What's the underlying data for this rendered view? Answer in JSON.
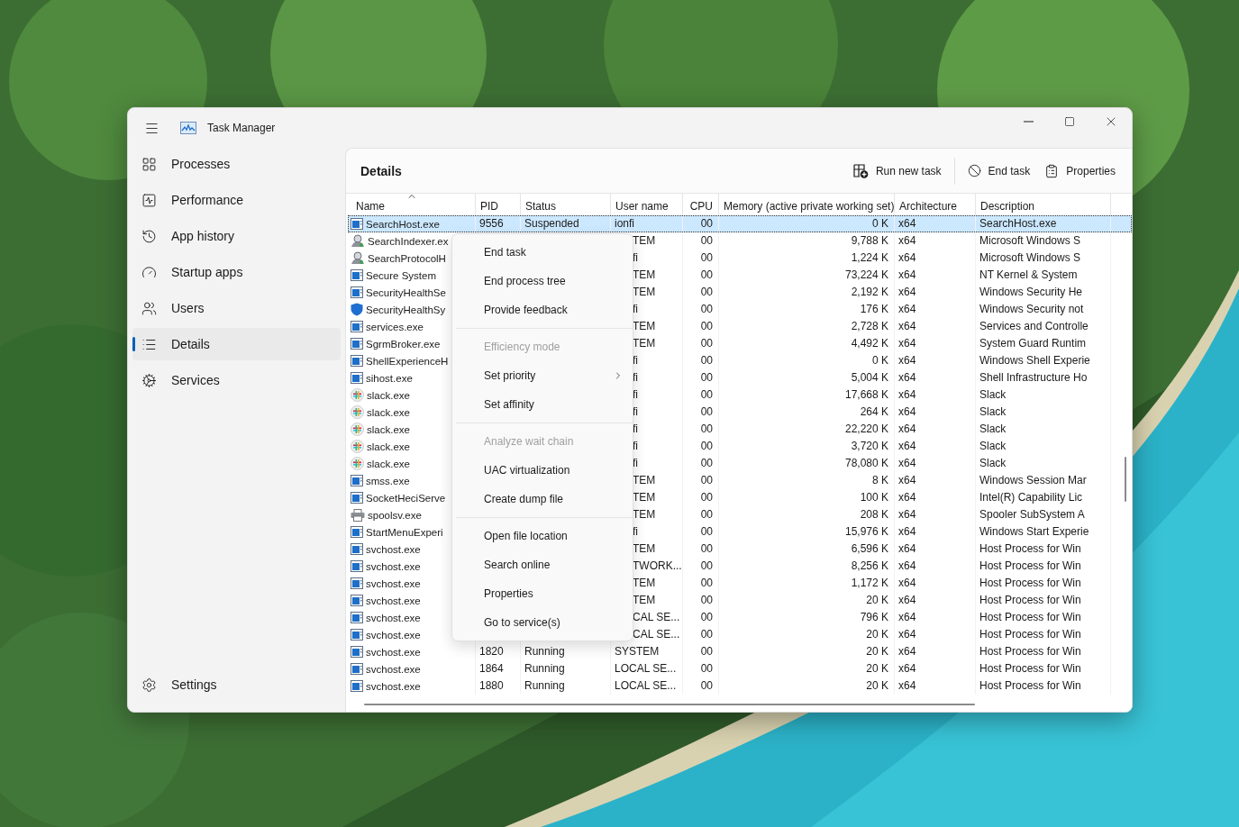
{
  "window": {
    "title": "Task Manager"
  },
  "sidebar": {
    "items": [
      {
        "label": "Processes",
        "selected": false
      },
      {
        "label": "Performance",
        "selected": false
      },
      {
        "label": "App history",
        "selected": false
      },
      {
        "label": "Startup apps",
        "selected": false
      },
      {
        "label": "Users",
        "selected": false
      },
      {
        "label": "Details",
        "selected": true
      },
      {
        "label": "Services",
        "selected": false
      }
    ],
    "footer": {
      "label": "Settings"
    }
  },
  "panel": {
    "title": "Details",
    "actions": [
      "Run new task",
      "End task",
      "Properties"
    ]
  },
  "table": {
    "columns": [
      {
        "label": "Name",
        "sorted": true
      },
      {
        "label": "PID",
        "sorted": false
      },
      {
        "label": "Status",
        "sorted": false
      },
      {
        "label": "User name",
        "sorted": false
      },
      {
        "label": "CPU",
        "sorted": false
      },
      {
        "label": "Memory (active private working set)",
        "sorted": false
      },
      {
        "label": "Architecture",
        "sorted": false
      },
      {
        "label": "Description",
        "sorted": false
      }
    ],
    "rows": [
      {
        "kind": "app",
        "name": "SearchHost.exe",
        "pid": "9556",
        "status": "Suspended",
        "user": "ionfi",
        "cpu": "00",
        "memory": "0 K",
        "architecture": "x64",
        "description": "SearchHost.exe",
        "selected": true
      },
      {
        "kind": "search",
        "name": "SearchIndexer.ex",
        "user": "TEM",
        "cpu": "00",
        "memory": "9,788 K",
        "architecture": "x64",
        "description": "Microsoft Windows S",
        "selected": false
      },
      {
        "kind": "search",
        "name": "SearchProtocolH",
        "user": "fi",
        "cpu": "00",
        "memory": "1,224 K",
        "architecture": "x64",
        "description": "Microsoft Windows S",
        "selected": false
      },
      {
        "kind": "app",
        "name": "Secure System",
        "user": "TEM",
        "cpu": "00",
        "memory": "73,224 K",
        "architecture": "x64",
        "description": "NT Kernel & System",
        "selected": false
      },
      {
        "kind": "app",
        "name": "SecurityHealthSe",
        "user": "TEM",
        "cpu": "00",
        "memory": "2,192 K",
        "architecture": "x64",
        "description": "Windows Security He",
        "selected": false
      },
      {
        "kind": "shield",
        "name": "SecurityHealthSy",
        "user": "fi",
        "cpu": "00",
        "memory": "176 K",
        "architecture": "x64",
        "description": "Windows Security not",
        "selected": false
      },
      {
        "kind": "app",
        "name": "services.exe",
        "user": "TEM",
        "cpu": "00",
        "memory": "2,728 K",
        "architecture": "x64",
        "description": "Services and Controlle",
        "selected": false
      },
      {
        "kind": "app",
        "name": "SgrmBroker.exe",
        "user": "TEM",
        "cpu": "00",
        "memory": "4,492 K",
        "architecture": "x64",
        "description": "System Guard Runtim",
        "selected": false
      },
      {
        "kind": "app",
        "name": "ShellExperienceH",
        "user": "fi",
        "cpu": "00",
        "memory": "0 K",
        "architecture": "x64",
        "description": "Windows Shell Experie",
        "selected": false
      },
      {
        "kind": "app",
        "name": "sihost.exe",
        "user": "fi",
        "cpu": "00",
        "memory": "5,004 K",
        "architecture": "x64",
        "description": "Shell Infrastructure Ho",
        "selected": false
      },
      {
        "kind": "slack",
        "name": "slack.exe",
        "user": "fi",
        "cpu": "00",
        "memory": "17,668 K",
        "architecture": "x64",
        "description": "Slack",
        "selected": false
      },
      {
        "kind": "slack",
        "name": "slack.exe",
        "user": "fi",
        "cpu": "00",
        "memory": "264 K",
        "architecture": "x64",
        "description": "Slack",
        "selected": false
      },
      {
        "kind": "slack",
        "name": "slack.exe",
        "user": "fi",
        "cpu": "00",
        "memory": "22,220 K",
        "architecture": "x64",
        "description": "Slack",
        "selected": false
      },
      {
        "kind": "slack",
        "name": "slack.exe",
        "user": "fi",
        "cpu": "00",
        "memory": "3,720 K",
        "architecture": "x64",
        "description": "Slack",
        "selected": false
      },
      {
        "kind": "slack",
        "name": "slack.exe",
        "user": "fi",
        "cpu": "00",
        "memory": "78,080 K",
        "architecture": "x64",
        "description": "Slack",
        "selected": false
      },
      {
        "kind": "app",
        "name": "smss.exe",
        "user": "TEM",
        "cpu": "00",
        "memory": "8 K",
        "architecture": "x64",
        "description": "Windows Session Mar",
        "selected": false
      },
      {
        "kind": "app",
        "name": "SocketHeciServe",
        "user": "TEM",
        "cpu": "00",
        "memory": "100 K",
        "architecture": "x64",
        "description": "Intel(R) Capability Lic",
        "selected": false
      },
      {
        "kind": "printer",
        "name": "spoolsv.exe",
        "user": "TEM",
        "cpu": "00",
        "memory": "208 K",
        "architecture": "x64",
        "description": "Spooler SubSystem A",
        "selected": false
      },
      {
        "kind": "app",
        "name": "StartMenuExperi",
        "user": "fi",
        "cpu": "00",
        "memory": "15,976 K",
        "architecture": "x64",
        "description": "Windows Start Experie",
        "selected": false
      },
      {
        "kind": "app",
        "name": "svchost.exe",
        "user": "TEM",
        "cpu": "00",
        "memory": "6,596 K",
        "architecture": "x64",
        "description": "Host Process for Win",
        "selected": false
      },
      {
        "kind": "app",
        "name": "svchost.exe",
        "user": "TWORK...",
        "cpu": "00",
        "memory": "8,256 K",
        "architecture": "x64",
        "description": "Host Process for Win",
        "selected": false
      },
      {
        "kind": "app",
        "name": "svchost.exe",
        "user": "TEM",
        "cpu": "00",
        "memory": "1,172 K",
        "architecture": "x64",
        "description": "Host Process for Win",
        "selected": false
      },
      {
        "kind": "app",
        "name": "svchost.exe",
        "user": "TEM",
        "cpu": "00",
        "memory": "20 K",
        "architecture": "x64",
        "description": "Host Process for Win",
        "selected": false
      },
      {
        "kind": "app",
        "name": "svchost.exe",
        "user": "CAL SE...",
        "cpu": "00",
        "memory": "796 K",
        "architecture": "x64",
        "description": "Host Process for Win",
        "selected": false
      },
      {
        "kind": "app",
        "name": "svchost.exe",
        "user": "CAL SE...",
        "cpu": "00",
        "memory": "20 K",
        "architecture": "x64",
        "description": "Host Process for Win",
        "selected": false
      },
      {
        "kind": "app",
        "name": "svchost.exe",
        "pid": "1820",
        "status": "Running",
        "user": "SYSTEM",
        "cpu": "00",
        "memory": "20 K",
        "architecture": "x64",
        "description": "Host Process for Win",
        "selected": false
      },
      {
        "kind": "app",
        "name": "svchost.exe",
        "pid": "1864",
        "status": "Running",
        "user": "LOCAL SE...",
        "cpu": "00",
        "memory": "20 K",
        "architecture": "x64",
        "description": "Host Process for Win",
        "selected": false
      },
      {
        "kind": "app",
        "name": "svchost.exe",
        "pid": "1880",
        "status": "Running",
        "user": "LOCAL SE...",
        "cpu": "00",
        "memory": "20 K",
        "architecture": "x64",
        "description": "Host Process for Win",
        "selected": false
      }
    ]
  },
  "context_menu": {
    "items": [
      {
        "kind": "item",
        "label": "End task",
        "disabled": false,
        "submenu": false
      },
      {
        "kind": "item",
        "label": "End process tree",
        "disabled": false,
        "submenu": false
      },
      {
        "kind": "item",
        "label": "Provide feedback",
        "disabled": false,
        "submenu": false
      },
      {
        "kind": "separator"
      },
      {
        "kind": "item",
        "label": "Efficiency mode",
        "disabled": true,
        "submenu": false
      },
      {
        "kind": "item",
        "label": "Set priority",
        "disabled": false,
        "submenu": true
      },
      {
        "kind": "item",
        "label": "Set affinity",
        "disabled": false,
        "submenu": false
      },
      {
        "kind": "separator"
      },
      {
        "kind": "item",
        "label": "Analyze wait chain",
        "disabled": true,
        "submenu": false
      },
      {
        "kind": "item",
        "label": "UAC virtualization",
        "disabled": false,
        "submenu": false
      },
      {
        "kind": "item",
        "label": "Create dump file",
        "disabled": false,
        "submenu": false
      },
      {
        "kind": "separator"
      },
      {
        "kind": "item",
        "label": "Open file location",
        "disabled": false,
        "submenu": false
      },
      {
        "kind": "item",
        "label": "Search online",
        "disabled": false,
        "submenu": false
      },
      {
        "kind": "item",
        "label": "Properties",
        "disabled": false,
        "submenu": false
      },
      {
        "kind": "item",
        "label": "Go to service(s)",
        "disabled": false,
        "submenu": false
      }
    ]
  }
}
